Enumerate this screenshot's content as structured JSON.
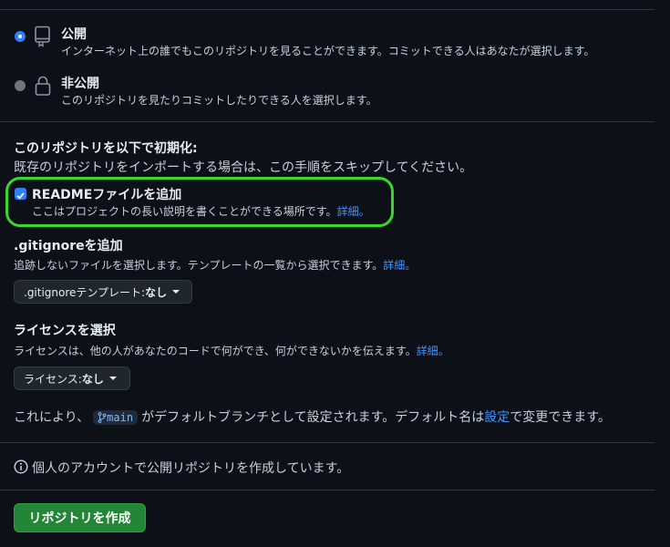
{
  "visibility": {
    "public": {
      "title": "公開",
      "description": "インターネット上の誰でもこのリポジトリを見ることができます。コミットできる人はあなたが選択します。",
      "selected": true
    },
    "private": {
      "title": "非公開",
      "description": "このリポジトリを見たりコミットしたりできる人を選択します。",
      "selected": false
    }
  },
  "init": {
    "heading": "このリポジトリを以下で初期化:",
    "subtext": "既存のリポジトリをインポートする場合は、この手順をスキップしてください。",
    "readme": {
      "label": "READMEファイルを追加",
      "description": "ここはプロジェクトの長い説明を書くことができる場所です。",
      "link": "詳細。",
      "checked": true
    }
  },
  "gitignore": {
    "heading": ".gitignoreを追加",
    "description": "追跡しないファイルを選択します。テンプレートの一覧から選択できます。",
    "link": "詳細。",
    "select_prefix": ".gitignoreテンプレート: ",
    "select_value": "なし"
  },
  "license": {
    "heading": "ライセンスを選択",
    "description": "ライセンスは、他の人があなたのコードで何ができ、何ができないかを伝えます。",
    "link": "詳細。",
    "select_prefix": "ライセンス: ",
    "select_value": "なし"
  },
  "branch_note": {
    "before": "これにより、",
    "branch": "main",
    "middle": "がデフォルトブランチとして設定されます。デフォルト名は",
    "settings_link": "設定",
    "after": "で変更できます。"
  },
  "info_note": "個人のアカウントで公開リポジトリを作成しています。",
  "create_button": "リポジトリを作成",
  "colors": {
    "background": "#0d1117",
    "accent": "#2f81f7",
    "link": "#4493f8",
    "primary_button": "#238636",
    "highlight_outline": "#37d928"
  }
}
